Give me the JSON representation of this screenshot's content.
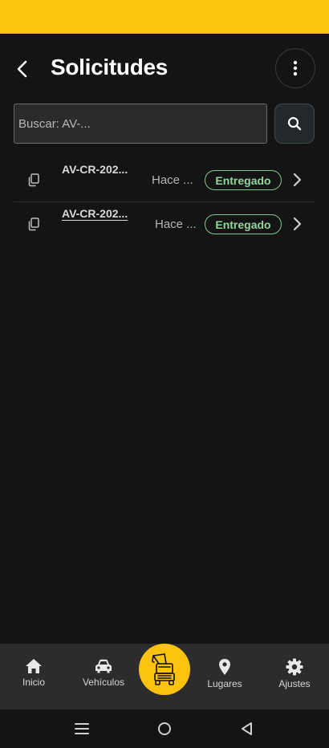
{
  "colors": {
    "accent": "#fbc20e",
    "background": "#141414",
    "status_ok": "#8fd89a",
    "nav_bg": "#2c2c2c"
  },
  "header": {
    "title": "Solicitudes",
    "back_icon": "arrow-left-icon",
    "menu_icon": "more-vertical-icon"
  },
  "search": {
    "placeholder": "Buscar: AV-...",
    "value": "",
    "icon": "search-icon"
  },
  "requests": [
    {
      "id": "AV-CR-202...",
      "time": "Hace ...",
      "status": "Entregado"
    },
    {
      "id": "AV-CR-202...",
      "time": "Hace ...",
      "status": "Entregado"
    }
  ],
  "bottom_nav": {
    "items": [
      {
        "label": "Inicio",
        "icon": "home-icon"
      },
      {
        "label": "Vehículos",
        "icon": "car-icon"
      },
      {
        "label": "Lugares",
        "icon": "map-pin-icon"
      },
      {
        "label": "Ajustes",
        "icon": "gear-icon"
      }
    ],
    "center_icon": "tow-truck-icon"
  }
}
